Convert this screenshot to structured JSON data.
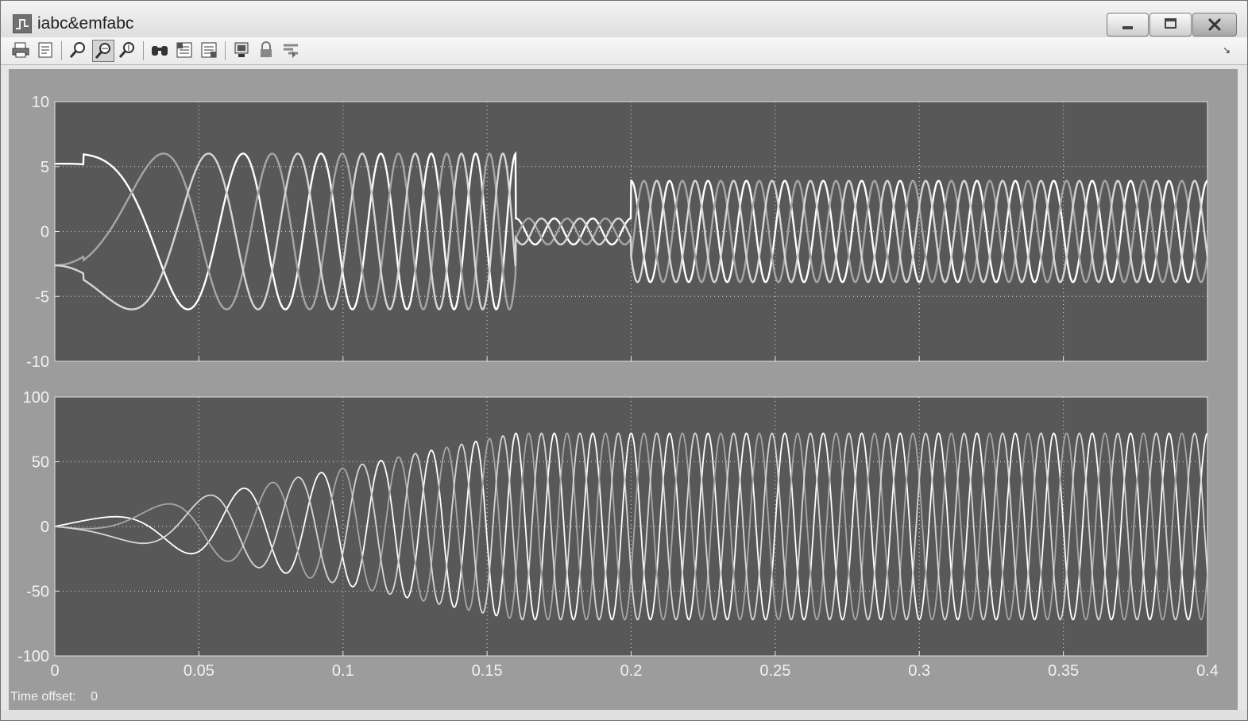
{
  "window": {
    "title": "iabc&emfabc"
  },
  "toolbar": {
    "tools": [
      "print-icon",
      "parameters-icon",
      "zoom-icon",
      "zoom-x-icon",
      "zoom-y-icon",
      "autoscale-icon",
      "save-axes-icon",
      "restore-axes-icon",
      "floating-scope-icon",
      "lock-axes-icon",
      "signal-selector-icon"
    ],
    "active_tool": "zoom-x-icon",
    "dock_glyph": "↘"
  },
  "status": {
    "time_offset_label": "Time offset:",
    "time_offset_value": "0"
  },
  "colors": {
    "axes_bg": "#585858",
    "figure_bg": "#9c9c9c",
    "trace_bright": "#ffffff",
    "trace_mid": "#d6d6d6",
    "trace_dim": "#a6a6a6",
    "grid": "#c8c8c8"
  },
  "chart_data": [
    {
      "type": "line",
      "title": "",
      "xlabel": "",
      "ylabel": "",
      "xlim": [
        0,
        0.4
      ],
      "ylim": [
        -10,
        10
      ],
      "xticks": [
        0,
        0.05,
        0.1,
        0.15,
        0.2,
        0.25,
        0.3,
        0.35,
        0.4
      ],
      "xticklabels": [
        "",
        "",
        "",
        "",
        "",
        "",
        "",
        "",
        ""
      ],
      "yticks": [
        -10,
        -5,
        0,
        5,
        10
      ],
      "yticklabels": [
        "-10",
        "-5",
        "0",
        "5",
        "10"
      ],
      "grid": true,
      "phases_deg": [
        0,
        -120,
        120
      ],
      "segments": [
        {
          "t_start": 0,
          "t_end": 0.16,
          "amplitude": 6,
          "frequency_start_hz": 0,
          "frequency_end_hz": 75
        },
        {
          "t_start": 0.16,
          "t_end": 0.2,
          "amplitude": 1,
          "frequency_hz": 75
        },
        {
          "t_start": 0.2,
          "t_end": 0.4,
          "amplitude": 3.9,
          "frequency_hz": 75
        }
      ]
    },
    {
      "type": "line",
      "title": "",
      "xlabel": "",
      "ylabel": "",
      "xlim": [
        0,
        0.4
      ],
      "ylim": [
        -100,
        100
      ],
      "xticks": [
        0,
        0.05,
        0.1,
        0.15,
        0.2,
        0.25,
        0.3,
        0.35,
        0.4
      ],
      "xticklabels": [
        "0",
        "0.05",
        "0.1",
        "0.15",
        "0.2",
        "0.25",
        "0.3",
        "0.35",
        "0.4"
      ],
      "yticks": [
        -100,
        -50,
        0,
        50,
        100
      ],
      "yticklabels": [
        "-100",
        "-50",
        "0",
        "50",
        "100"
      ],
      "grid": true,
      "phases_deg": [
        0,
        -120,
        120
      ],
      "segments": [
        {
          "t_start": 0,
          "t_end": 0.16,
          "amplitude_start": 0,
          "amplitude_end": 72,
          "frequency_start_hz": 0,
          "frequency_end_hz": 75
        },
        {
          "t_start": 0.16,
          "t_end": 0.4,
          "amplitude": 72,
          "frequency_hz": 75
        }
      ]
    }
  ]
}
